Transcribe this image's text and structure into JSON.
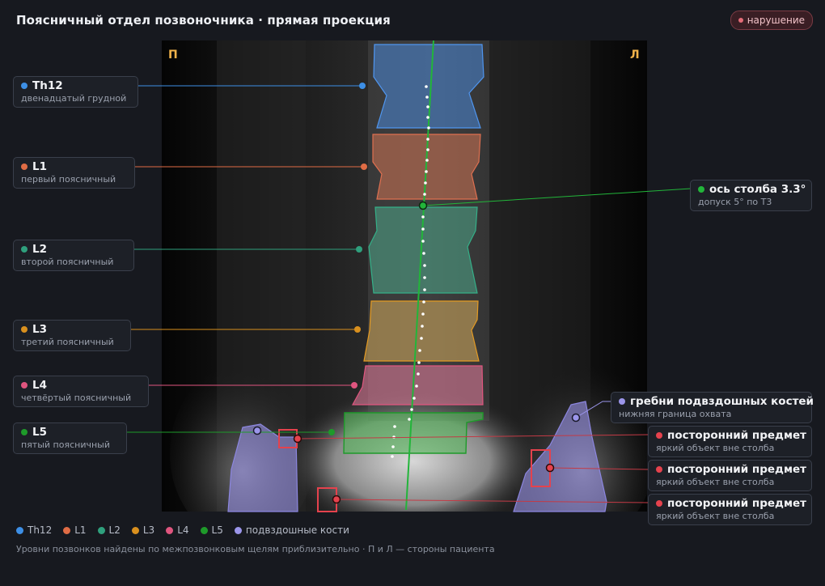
{
  "header": {
    "title": "Поясничный отдел позвоночника · прямая проекция",
    "status_badge": "нарушение"
  },
  "scan": {
    "side_right_marker": "П",
    "side_left_marker": "Л"
  },
  "labels": {
    "th12": {
      "name": "Th12",
      "sub": "двенадцатый грудной",
      "color": "#3d8fe6"
    },
    "l1": {
      "name": "L1",
      "sub": "первый поясничный",
      "color": "#e06c45"
    },
    "l2": {
      "name": "L2",
      "sub": "второй поясничный",
      "color": "#2fa07d"
    },
    "l3": {
      "name": "L3",
      "sub": "третий поясничный",
      "color": "#d9901e"
    },
    "l4": {
      "name": "L4",
      "sub": "четвёртый поясничный",
      "color": "#e0557f"
    },
    "l5": {
      "name": "L5",
      "sub": "пятый поясничный",
      "color": "#1e9a2a"
    },
    "axis": {
      "name": "ось столба 3.3°",
      "sub": "допуск 5° по Т3",
      "color": "#22b53a"
    },
    "iliac": {
      "name": "гребни подвздошных костей",
      "sub": "нижняя граница охвата",
      "color": "#9b95ea"
    },
    "foreign_1": {
      "name": "посторонний предмет",
      "sub": "яркий объект вне столба",
      "color": "#e5424d"
    },
    "foreign_2": {
      "name": "посторонний предмет",
      "sub": "яркий объект вне столба",
      "color": "#e5424d"
    },
    "foreign_3": {
      "name": "посторонний предмет",
      "sub": "яркий объект вне столба",
      "color": "#e5424d"
    }
  },
  "legend": [
    {
      "label": "Th12",
      "color": "#3d8fe6"
    },
    {
      "label": "L1",
      "color": "#e06c45"
    },
    {
      "label": "L2",
      "color": "#2fa07d"
    },
    {
      "label": "L3",
      "color": "#d9901e"
    },
    {
      "label": "L4",
      "color": "#e0557f"
    },
    {
      "label": "L5",
      "color": "#1e9a2a"
    },
    {
      "label": "подвздошные кости",
      "color": "#9b95ea"
    }
  ],
  "footnote": "Уровни позвонков найдены по межпозвонковым щелям приблизительно · П и Л — стороны пациента"
}
